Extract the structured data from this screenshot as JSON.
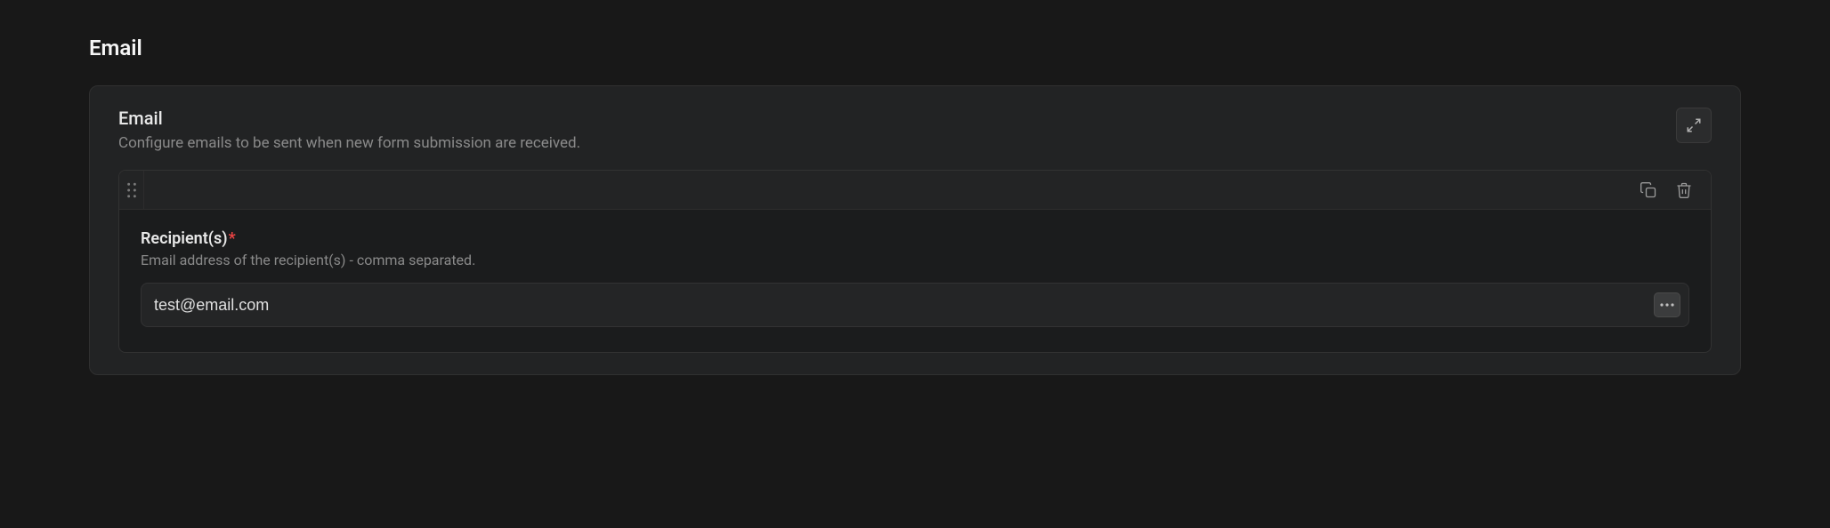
{
  "section": {
    "heading": "Email"
  },
  "panel": {
    "title": "Email",
    "subtitle": "Configure emails to be sent when new form submission are received."
  },
  "field": {
    "label": "Recipient(s)",
    "required_mark": "*",
    "help": "Email address of the recipient(s) - comma separated.",
    "value": "test@email.com"
  }
}
